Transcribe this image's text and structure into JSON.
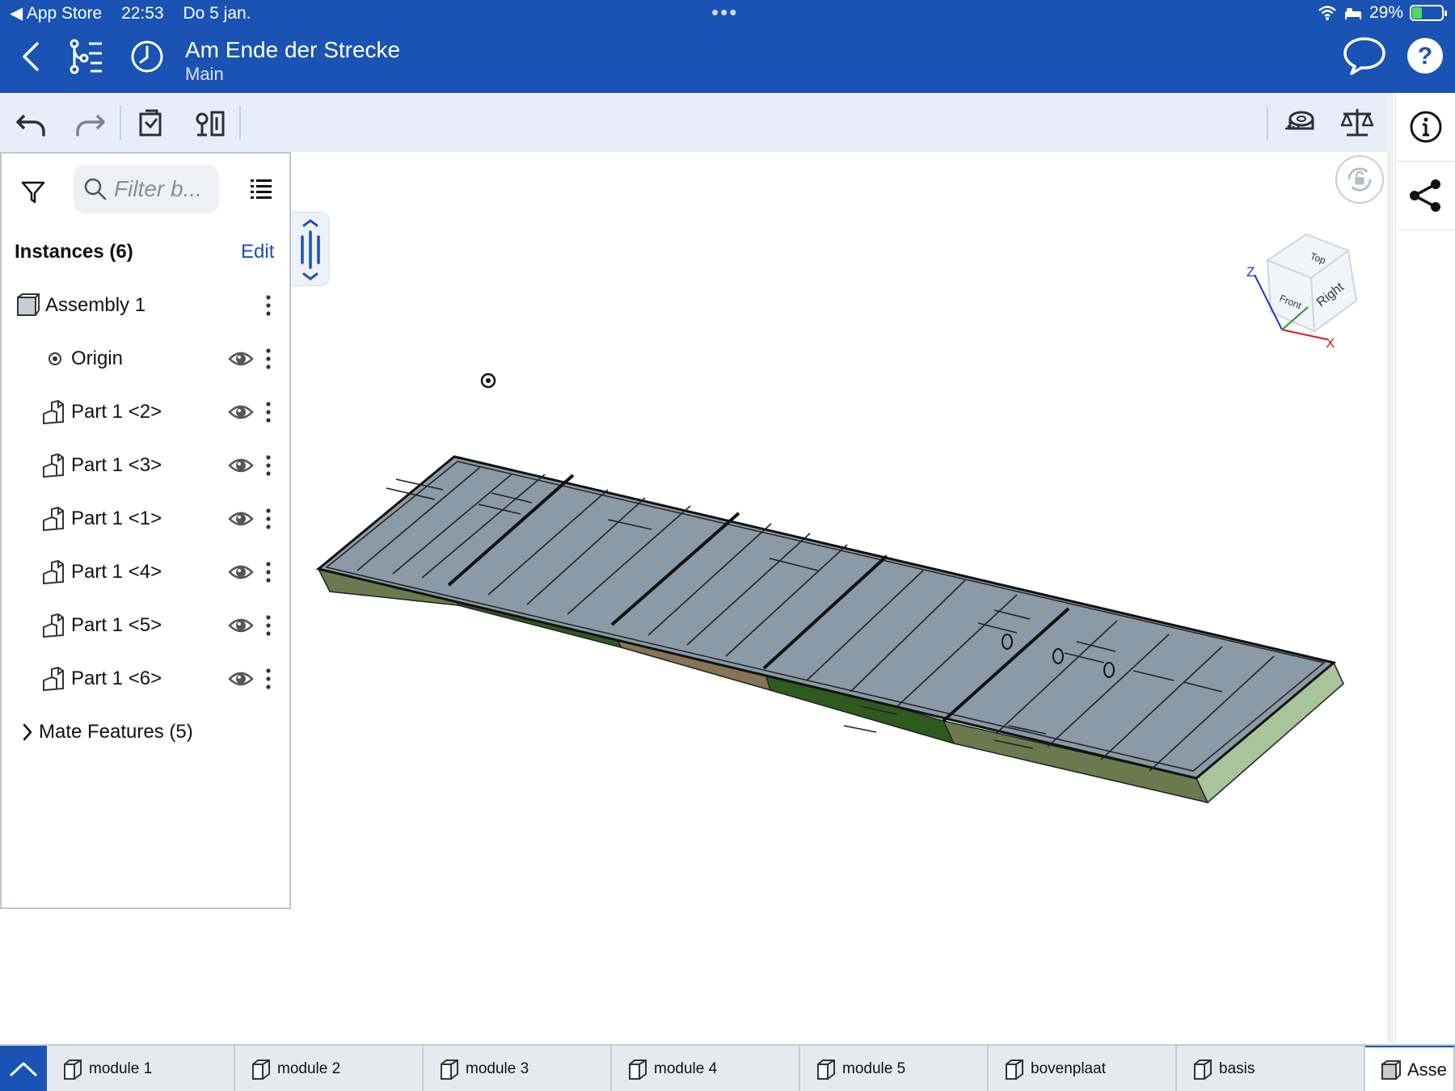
{
  "status_bar": {
    "back_app": "◀ App Store",
    "time": "22:53",
    "date": "Do 5 jan.",
    "multitask_dots": "•••",
    "battery_text": "29%"
  },
  "header": {
    "title": "Am Ende der Strecke",
    "subtitle": "Main"
  },
  "panel": {
    "search_placeholder": "Filter b...",
    "instances_title": "Instances (6)",
    "edit_label": "Edit",
    "tree": [
      {
        "label": "Assembly 1",
        "type": "assembly",
        "eye": false
      },
      {
        "label": "Origin",
        "type": "origin",
        "eye": true
      },
      {
        "label": "Part 1 <2>",
        "type": "part",
        "eye": true
      },
      {
        "label": "Part 1 <3>",
        "type": "part",
        "eye": true
      },
      {
        "label": "Part 1 <1>",
        "type": "part",
        "eye": true
      },
      {
        "label": "Part 1 <4>",
        "type": "part",
        "eye": true
      },
      {
        "label": "Part 1 <5>",
        "type": "part",
        "eye": true
      },
      {
        "label": "Part 1 <6>",
        "type": "part",
        "eye": true
      }
    ],
    "mate_features": "Mate Features (5)"
  },
  "viewcube": {
    "top": "Top",
    "front": "Front",
    "right": "Right",
    "axis_z": "Z",
    "axis_x": "X"
  },
  "tabs": [
    {
      "label": "module 1"
    },
    {
      "label": "module 2"
    },
    {
      "label": "module 3"
    },
    {
      "label": "module 4"
    },
    {
      "label": "module 5"
    },
    {
      "label": "bovenplaat"
    },
    {
      "label": "basis"
    },
    {
      "label": "Asse"
    }
  ],
  "colors": {
    "brand_blue": "#1a53b3",
    "toolbar_bg": "#e8eef8",
    "panel_top": "#8a9aa6",
    "module_green_dark": "#2f5a1e",
    "module_olive": "#6b7a4e",
    "module_tan": "#857457",
    "module_light_green": "#a9c49a"
  }
}
